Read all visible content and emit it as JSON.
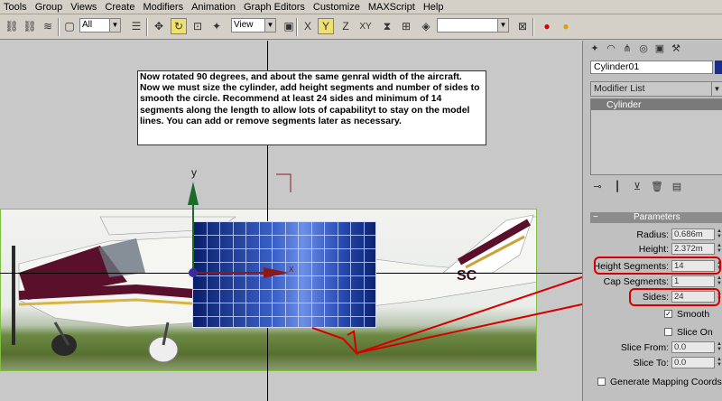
{
  "menu": [
    "Tools",
    "Group",
    "Views",
    "Create",
    "Modifiers",
    "Animation",
    "Graph Editors",
    "Customize",
    "MAXScript",
    "Help"
  ],
  "toolbar": {
    "selection_filter": "All",
    "reference_coord": "View",
    "named_selection": "",
    "axis_constraints": [
      "X",
      "Y",
      "Z",
      "XY"
    ]
  },
  "viewport": {
    "instruction_note": "Now rotated 90 degrees, and about the same genral width of the aircraft.  Now we must size the cylinder, add height segments and number of sides to smooth the circle.   Recommend at least 24 sides and minimum of 14 segments along the length to allow lots of capabilityt to stay on the model lines.  You can add or remove segments later as necessary.",
    "gizmo": {
      "y_label": "y",
      "x_label": "x"
    },
    "colors": {
      "gizmo_y": "#1a6a2a",
      "gizmo_x": "#8a1a1a",
      "annotation": "#d40000",
      "cylinder": "#2a4fb8"
    }
  },
  "command_panel": {
    "object_name": "Cylinder01",
    "modifier_list": "Modifier List",
    "stack_items": [
      "Cylinder"
    ],
    "rollout_title": "Parameters",
    "params": [
      {
        "label": "Radius:",
        "value": "0.686m"
      },
      {
        "label": "Height:",
        "value": "2.372m"
      },
      {
        "label": "Height Segments:",
        "value": "14"
      },
      {
        "label": "Cap Segments:",
        "value": "1"
      },
      {
        "label": "Sides:",
        "value": "24"
      }
    ],
    "smooth": {
      "label": "Smooth",
      "checked": true
    },
    "slice_on": {
      "label": "Slice On",
      "checked": false
    },
    "slice_from": {
      "label": "Slice From:",
      "value": "0.0"
    },
    "slice_to": {
      "label": "Slice To:",
      "value": "0.0"
    },
    "gen_mapping": {
      "label": "Generate Mapping Coords.",
      "checked": false
    }
  }
}
